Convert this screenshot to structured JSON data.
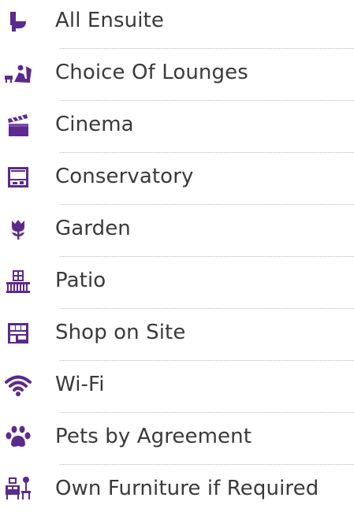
{
  "accent_color": "#5c2a8c",
  "amenities": [
    {
      "label": "All Ensuite",
      "icon": "toilet-icon"
    },
    {
      "label": "Choice Of Lounges",
      "icon": "lounge-icon"
    },
    {
      "label": "Cinema",
      "icon": "clapperboard-icon"
    },
    {
      "label": "Conservatory",
      "icon": "conservatory-icon"
    },
    {
      "label": "Garden",
      "icon": "flower-icon"
    },
    {
      "label": "Patio",
      "icon": "patio-icon"
    },
    {
      "label": "Shop on Site",
      "icon": "shop-icon"
    },
    {
      "label": "Wi-Fi",
      "icon": "wifi-icon"
    },
    {
      "label": "Pets by Agreement",
      "icon": "paw-icon"
    },
    {
      "label": "Own Furniture if Required",
      "icon": "furniture-icon"
    }
  ]
}
